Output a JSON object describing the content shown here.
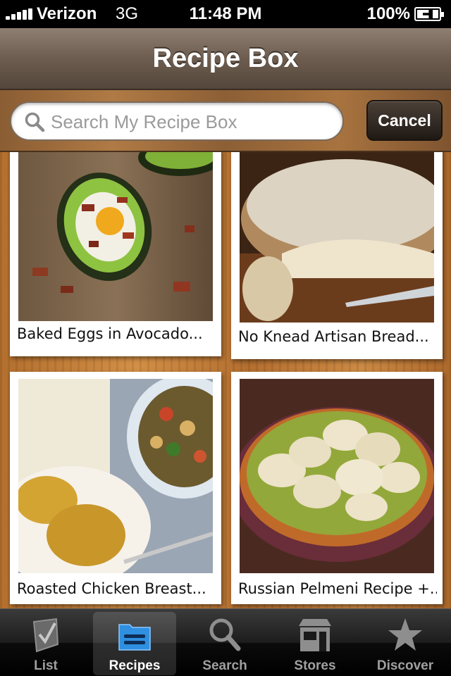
{
  "status_bar": {
    "carrier": "Verizon",
    "network": "3G",
    "time": "11:48 PM",
    "battery": "100%"
  },
  "nav": {
    "title": "Recipe Box"
  },
  "search": {
    "placeholder": "Search My Recipe Box",
    "value": "",
    "cancel_label": "Cancel"
  },
  "recipes": [
    {
      "title": "Baked Eggs in Avocado...",
      "image": "baked-eggs-avocado-photo"
    },
    {
      "title": "No Knead Artisan Bread...",
      "image": "artisan-bread-photo"
    },
    {
      "title": "Roasted Chicken Breast...",
      "image": "roasted-chicken-photo"
    },
    {
      "title": "Russian Pelmeni Recipe +...",
      "image": "pelmeni-photo"
    }
  ],
  "tabs": [
    {
      "label": "List",
      "icon": "checklist-icon",
      "selected": false
    },
    {
      "label": "Recipes",
      "icon": "folder-icon",
      "selected": true
    },
    {
      "label": "Search",
      "icon": "search-icon",
      "selected": false
    },
    {
      "label": "Stores",
      "icon": "store-icon",
      "selected": false
    },
    {
      "label": "Discover",
      "icon": "star-icon",
      "selected": false
    }
  ],
  "colors": {
    "nav": "#6d5d50",
    "wood": "#b87635",
    "tab_selected": "#2f8fe0"
  }
}
